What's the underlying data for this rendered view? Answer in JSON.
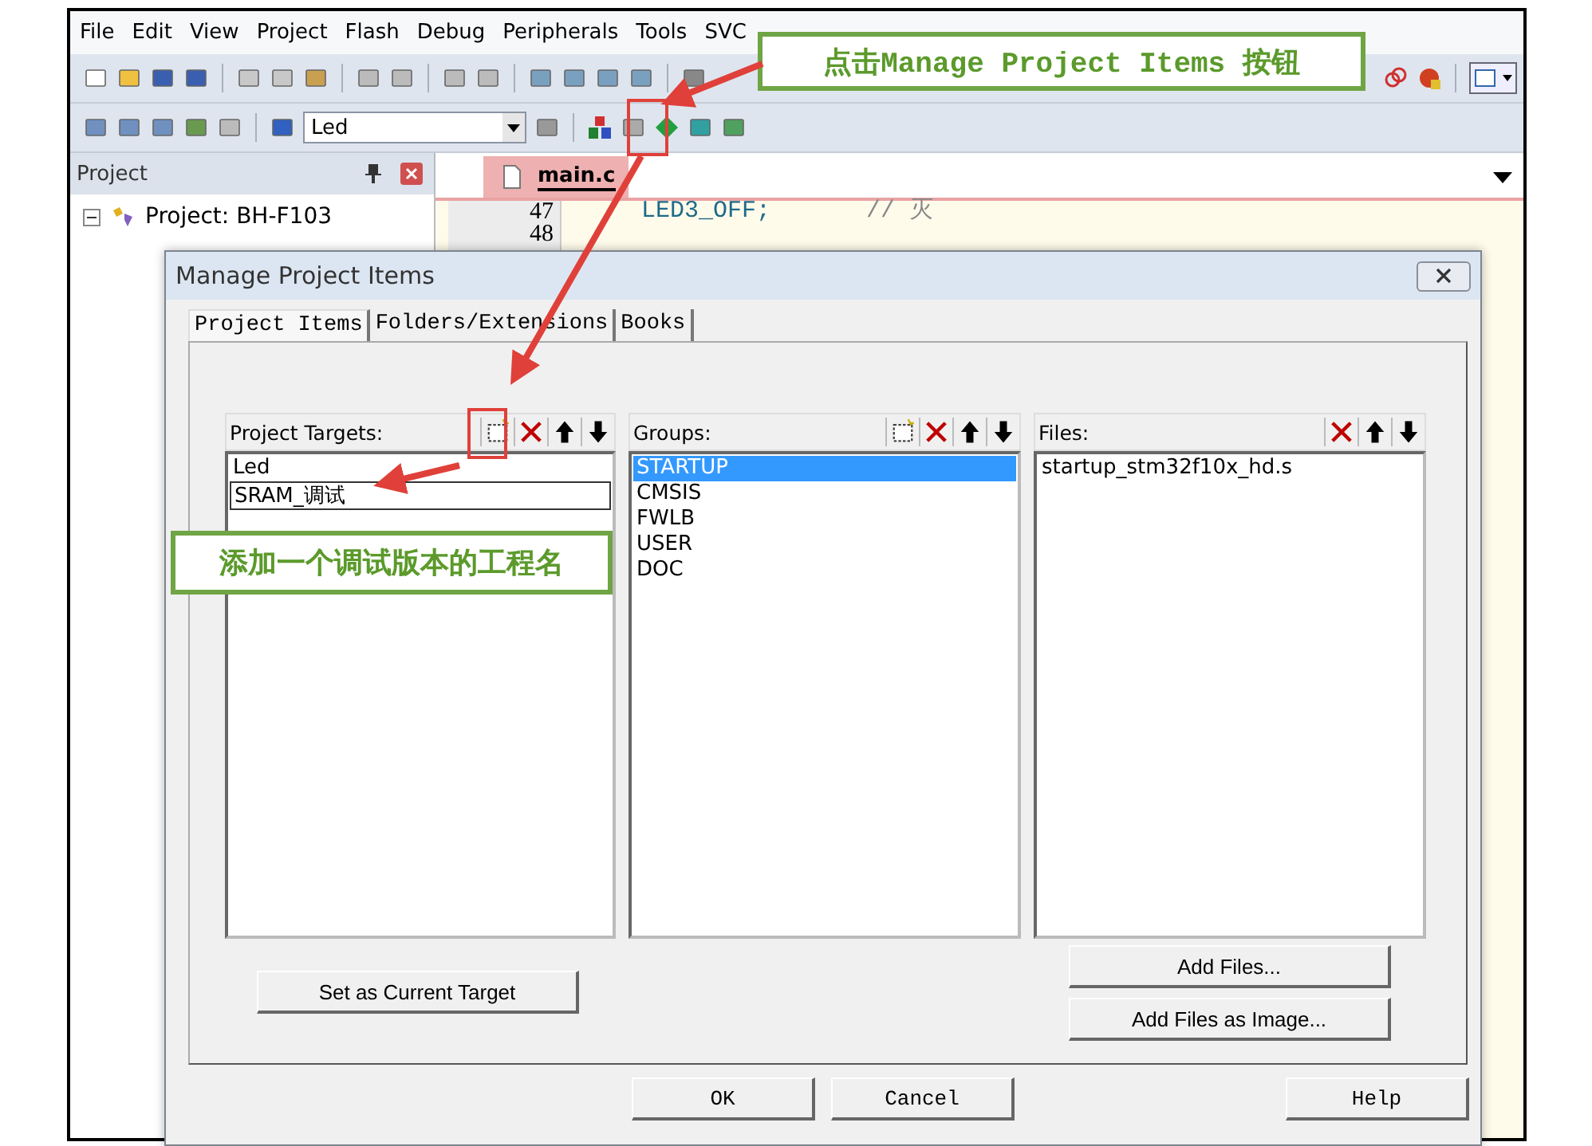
{
  "menu": [
    "File",
    "Edit",
    "View",
    "Project",
    "Flash",
    "Debug",
    "Peripherals",
    "Tools",
    "SVC"
  ],
  "toolbar": {
    "target_select": "Led"
  },
  "project_panel": {
    "title": "Project",
    "tree": [
      {
        "label": "Project: BH-F103",
        "expanded": true
      }
    ]
  },
  "editor": {
    "tab": "main.c",
    "lines": [
      {
        "number": "47",
        "code": "LED3_OFF;",
        "comment": "// 灭"
      },
      {
        "number": "48"
      }
    ]
  },
  "dialog": {
    "title": "Manage Project Items",
    "tabs": [
      {
        "label": "Project Items",
        "selected": true
      },
      {
        "label": "Folders/Extensions",
        "selected": false
      },
      {
        "label": "Books",
        "selected": false
      }
    ],
    "lists": [
      {
        "label": "Project Targets:",
        "tools": [
          {
            "kind": "new"
          },
          {
            "kind": "delete"
          },
          {
            "kind": "up"
          },
          {
            "kind": "down"
          }
        ],
        "items": [
          {
            "text": "Led",
            "selected": false,
            "editing": false
          },
          {
            "text": "SRAM_调试",
            "selected": false,
            "editing": true
          }
        ]
      },
      {
        "label": "Groups:",
        "tools": [
          {
            "kind": "new"
          },
          {
            "kind": "delete"
          },
          {
            "kind": "up"
          },
          {
            "kind": "down"
          }
        ],
        "items": [
          {
            "text": "STARTUP",
            "selected": true,
            "editing": false
          },
          {
            "text": "CMSIS",
            "selected": false,
            "editing": false
          },
          {
            "text": "FWLB",
            "selected": false,
            "editing": false
          },
          {
            "text": "USER",
            "selected": false,
            "editing": false
          },
          {
            "text": "DOC",
            "selected": false,
            "editing": false
          }
        ]
      },
      {
        "label": "Files:",
        "tools": [
          {
            "kind": "delete"
          },
          {
            "kind": "up"
          },
          {
            "kind": "down"
          }
        ],
        "items": [
          {
            "text": "startup_stm32f10x_hd.s",
            "selected": false,
            "editing": false
          }
        ]
      }
    ],
    "set_target_button": "Set as Current Target",
    "add_buttons": [
      "Add Files...",
      "Add Files as Image..."
    ],
    "footer_buttons": [
      "OK",
      "Cancel",
      "Help"
    ]
  },
  "callouts": [
    {
      "text": "点击Manage Project Items 按钮"
    },
    {
      "text": "添加一个调试版本的工程名"
    }
  ]
}
